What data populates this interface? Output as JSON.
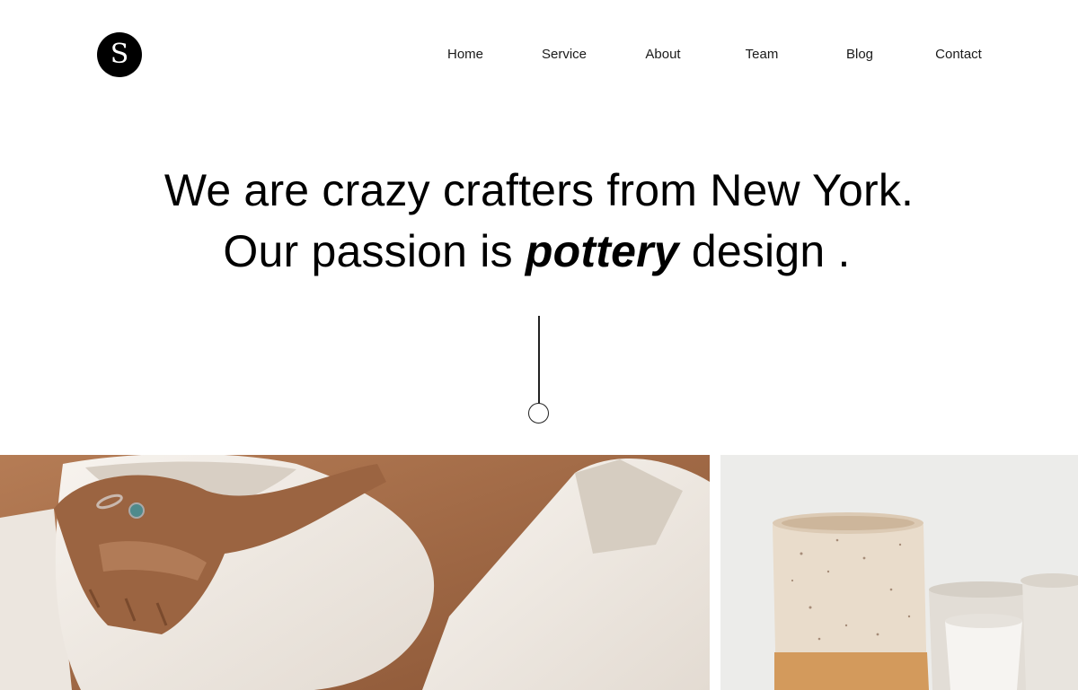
{
  "logo": {
    "letter": "S"
  },
  "nav": {
    "items": [
      {
        "label": "Home"
      },
      {
        "label": "Service"
      },
      {
        "label": "About"
      },
      {
        "label": "Team"
      },
      {
        "label": "Blog"
      },
      {
        "label": "Contact"
      }
    ]
  },
  "hero": {
    "line1": "We are crazy crafters from New York.",
    "line2_prefix": "Our passion is ",
    "line2_emphasis": "pottery",
    "line2_suffix": " design ."
  },
  "colors": {
    "text": "#000000",
    "background": "#ffffff",
    "logo_bg": "#000000"
  },
  "icons": {
    "scroll": "scroll-down-indicator-icon"
  }
}
